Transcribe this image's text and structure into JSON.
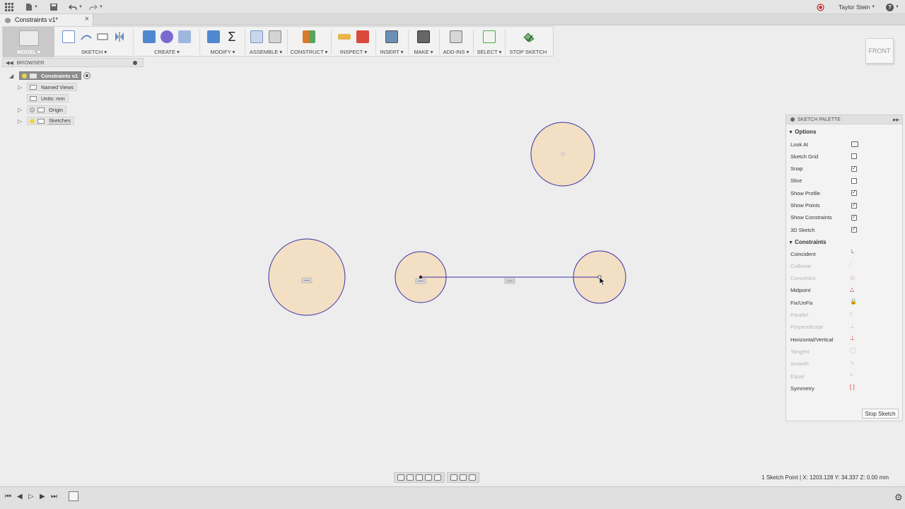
{
  "app": {
    "user_name": "Taylor Stein",
    "help_label": "?"
  },
  "document": {
    "tab_title": "Constraints v1*",
    "close_label": "×"
  },
  "ribbon": {
    "groups": [
      {
        "label": "MODEL"
      },
      {
        "label": "SKETCH"
      },
      {
        "label": "CREATE"
      },
      {
        "label": "MODIFY"
      },
      {
        "label": "ASSEMBLE"
      },
      {
        "label": "CONSTRUCT"
      },
      {
        "label": "INSPECT"
      },
      {
        "label": "INSERT"
      },
      {
        "label": "MAKE"
      },
      {
        "label": "ADD-INS"
      },
      {
        "label": "SELECT"
      },
      {
        "label": "STOP SKETCH"
      }
    ]
  },
  "viewcube": {
    "face": "FRONT"
  },
  "browser": {
    "title": "BROWSER",
    "root": "Constraints v1",
    "items": [
      {
        "label": "Named Views"
      },
      {
        "label": "Units: mm"
      },
      {
        "label": "Origin"
      },
      {
        "label": "Sketches"
      }
    ]
  },
  "sketch_palette": {
    "title": "SKETCH PALETTE",
    "options_title": "Options",
    "options": [
      {
        "label": "Look At",
        "checked": null
      },
      {
        "label": "Sketch Grid",
        "checked": false
      },
      {
        "label": "Snap",
        "checked": true
      },
      {
        "label": "Slice",
        "checked": false
      },
      {
        "label": "Show Profile",
        "checked": true
      },
      {
        "label": "Show Points",
        "checked": true
      },
      {
        "label": "Show Constraints",
        "checked": true
      },
      {
        "label": "3D Sketch",
        "checked": true
      }
    ],
    "constraints_title": "Constraints",
    "constraints": [
      {
        "label": "Coincident",
        "enabled": true
      },
      {
        "label": "Collinear",
        "enabled": false
      },
      {
        "label": "Concentric",
        "enabled": false
      },
      {
        "label": "Midpoint",
        "enabled": true
      },
      {
        "label": "Fix/UnFix",
        "enabled": true
      },
      {
        "label": "Parallel",
        "enabled": false
      },
      {
        "label": "Perpendicular",
        "enabled": false
      },
      {
        "label": "Horizontal/Vertical",
        "enabled": true
      },
      {
        "label": "Tangent",
        "enabled": false
      },
      {
        "label": "Smooth",
        "enabled": false
      },
      {
        "label": "Equal",
        "enabled": false
      },
      {
        "label": "Symmetry",
        "enabled": true
      }
    ],
    "stop_label": "Stop Sketch"
  },
  "status": {
    "text": "1 Sketch Point | X: 1203.128 Y: 34.337 Z: 0.00 mm"
  },
  "colors": {
    "profile_fill": "#f3dfc3",
    "sketch_line": "#3a31a8",
    "accent_red": "#d12a2a"
  }
}
